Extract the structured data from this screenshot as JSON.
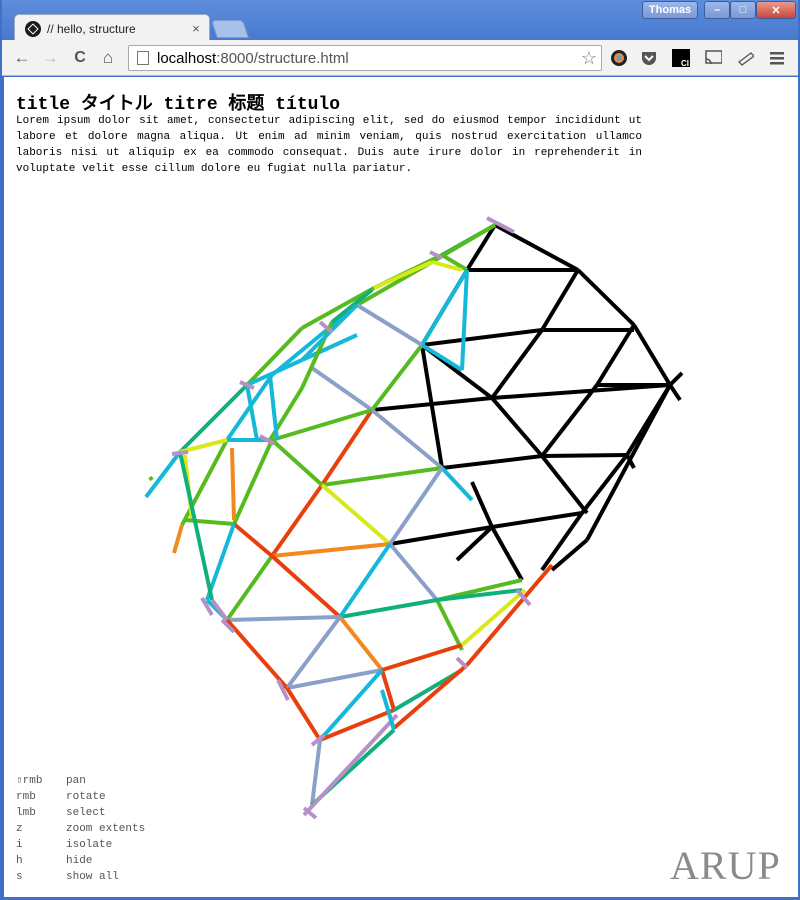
{
  "window": {
    "user": "Thomas",
    "minimize": "–",
    "maximize": "□",
    "close": "✕"
  },
  "tab": {
    "title": "// hello, structure",
    "close": "×"
  },
  "toolbar": {
    "back": "←",
    "forward": "→",
    "reload": "C",
    "home": "⌂",
    "url_host": "localhost",
    "url_path": ":8000/structure.html",
    "star": "☆"
  },
  "page": {
    "title": "title タイトル titre 标题 título",
    "body": "Lorem ipsum dolor sit amet, consectetur adipiscing elit, sed do eiusmod tempor incididunt ut labore et dolore magna aliqua. Ut enim ad minim veniam, quis nostrud exercitation ullamco laboris nisi ut aliquip ex ea commodo consequat. Duis aute irure dolor in reprehenderit in voluptate velit esse cillum dolore eu fugiat nulla pariatur."
  },
  "controls": [
    {
      "key": "⇧rmb",
      "action": "pan"
    },
    {
      "key": "rmb",
      "action": "rotate"
    },
    {
      "key": "lmb",
      "action": "select"
    },
    {
      "key": "z",
      "action": "zoom extents"
    },
    {
      "key": "i",
      "action": "isolate"
    },
    {
      "key": "h",
      "action": "hide"
    },
    {
      "key": "s",
      "action": "show all"
    }
  ],
  "logo": "ARUP",
  "colors": {
    "black": "#000000",
    "red": "#e8400c",
    "orange": "#f08a1c",
    "yellow": "#d8e81a",
    "green": "#56bb1e",
    "teal": "#10b07a",
    "cyan": "#14b8d8",
    "steel": "#8aa0c8",
    "lilac": "#b890c8"
  }
}
